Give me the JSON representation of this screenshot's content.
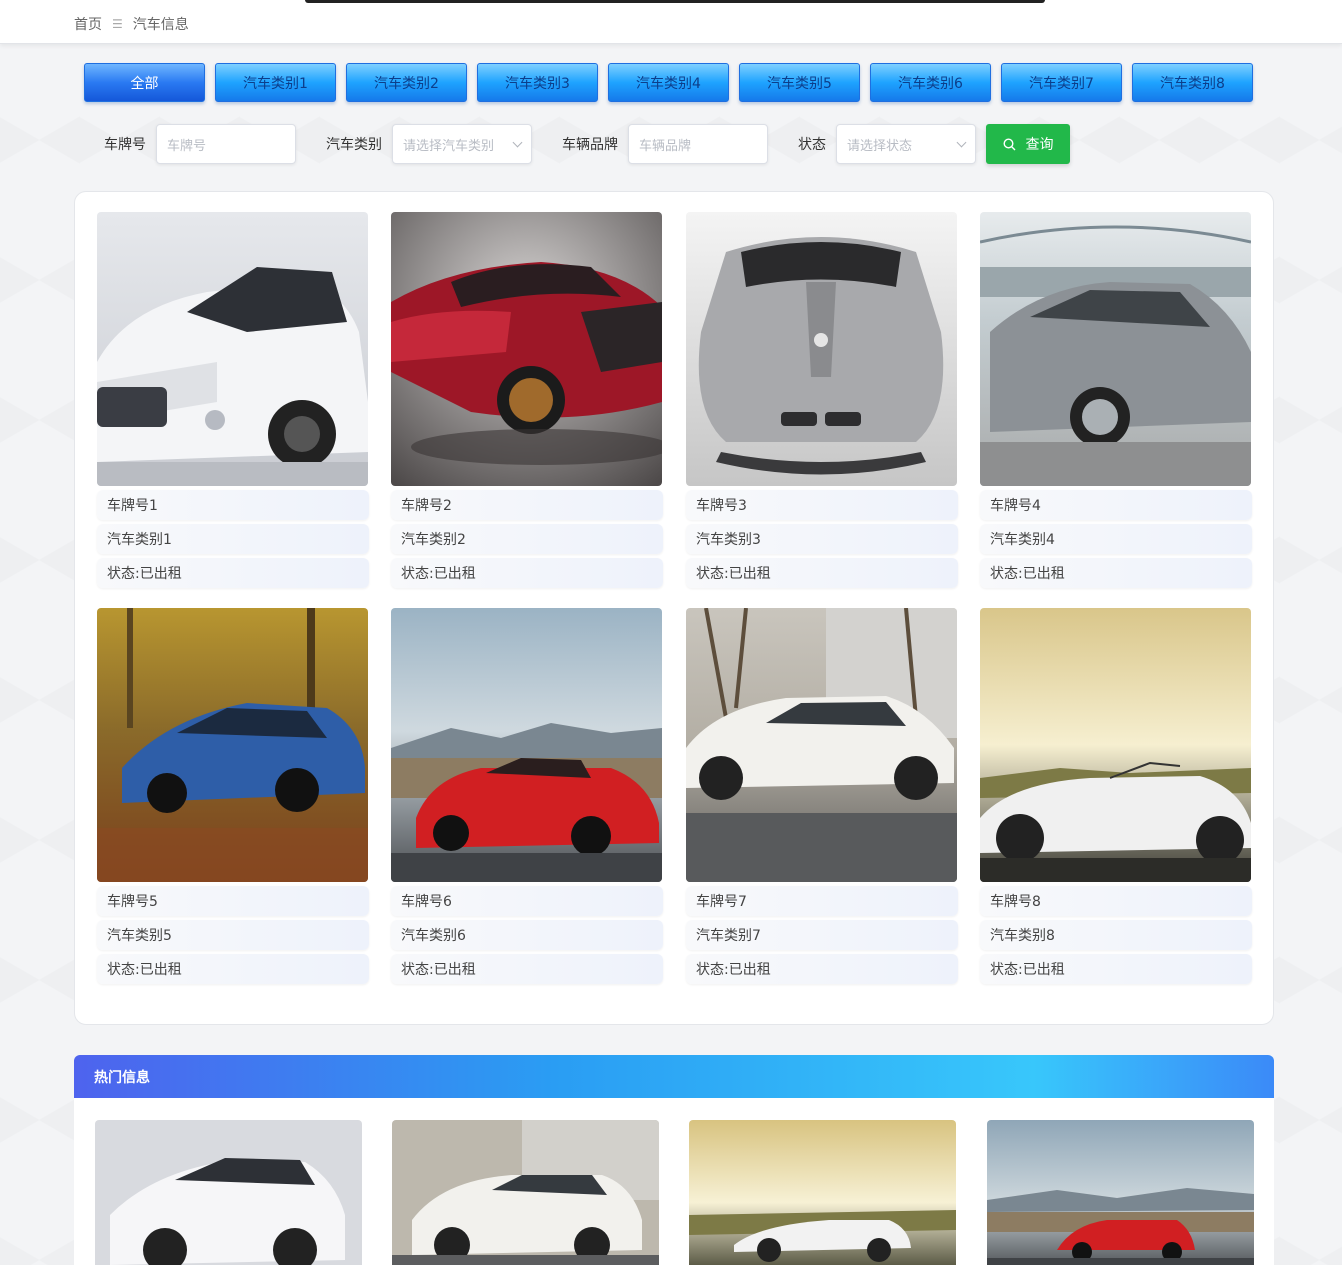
{
  "breadcrumb": {
    "home": "首页",
    "separator": "☰",
    "current": "汽车信息"
  },
  "categories": [
    "全部",
    "汽车类别1",
    "汽车类别2",
    "汽车类别3",
    "汽车类别4",
    "汽车类别5",
    "汽车类别6",
    "汽车类别7",
    "汽车类别8"
  ],
  "filters": {
    "plate_label": "车牌号",
    "plate_placeholder": "车牌号",
    "type_label": "汽车类别",
    "type_placeholder": "请选择汽车类别",
    "brand_label": "车辆品牌",
    "brand_placeholder": "车辆品牌",
    "status_label": "状态",
    "status_placeholder": "请选择状态",
    "search_button": "查询"
  },
  "cars": [
    {
      "plate": "车牌号1",
      "type": "汽车类别1",
      "status": "状态:已出租"
    },
    {
      "plate": "车牌号2",
      "type": "汽车类别2",
      "status": "状态:已出租"
    },
    {
      "plate": "车牌号3",
      "type": "汽车类别3",
      "status": "状态:已出租"
    },
    {
      "plate": "车牌号4",
      "type": "汽车类别4",
      "status": "状态:已出租"
    },
    {
      "plate": "车牌号5",
      "type": "汽车类别5",
      "status": "状态:已出租"
    },
    {
      "plate": "车牌号6",
      "type": "汽车类别6",
      "status": "状态:已出租"
    },
    {
      "plate": "车牌号7",
      "type": "汽车类别7",
      "status": "状态:已出租"
    },
    {
      "plate": "车牌号8",
      "type": "汽车类别8",
      "status": "状态:已出租"
    }
  ],
  "hot": {
    "title": "热门信息"
  },
  "colors": {
    "primary_blue": "#1ea3ff",
    "search_green": "#22b84a",
    "hot_gradient_start": "#4e63ee",
    "hot_gradient_end": "#38c7fb"
  }
}
